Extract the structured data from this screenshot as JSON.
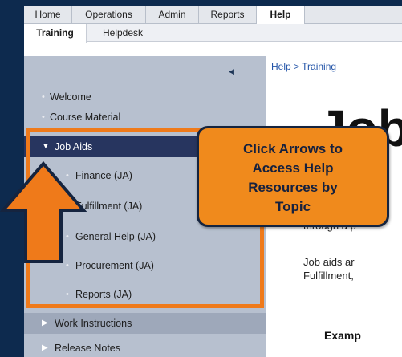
{
  "topnav": {
    "tabs": [
      {
        "label": "Home"
      },
      {
        "label": "Operations"
      },
      {
        "label": "Admin"
      },
      {
        "label": "Reports"
      },
      {
        "label": "Help"
      }
    ],
    "active": "Help"
  },
  "subnav": {
    "tabs": [
      {
        "label": "Training"
      },
      {
        "label": "Helpdesk"
      }
    ],
    "active": "Training"
  },
  "sidebar": {
    "items": [
      {
        "label": "Welcome"
      },
      {
        "label": "Course Material"
      },
      {
        "label": "Job Aids"
      },
      {
        "label": "Finance (JA)"
      },
      {
        "label": "Fulfillment (JA)"
      },
      {
        "label": "General Help (JA)"
      },
      {
        "label": "Procurement (JA)"
      },
      {
        "label": "Reports (JA)"
      },
      {
        "label": "Work Instructions"
      },
      {
        "label": "Release Notes"
      }
    ]
  },
  "breadcrumb": "Help  >  Training",
  "content": {
    "title": "Job",
    "para1": "through a p",
    "para2_line1": "Job aids ar",
    "para2_line2": "Fulfillment,",
    "example": "Examp"
  },
  "callout": {
    "line1": "Click Arrows to",
    "line2": "Access Help",
    "line3": "Resources by",
    "line4": "Topic"
  },
  "colors": {
    "frame": "#0d2a4e",
    "accent_orange": "#ef7a1a",
    "sidebar_bg": "#b7c0cf",
    "sidebar_selected": "#27355f",
    "link": "#2455a8"
  }
}
